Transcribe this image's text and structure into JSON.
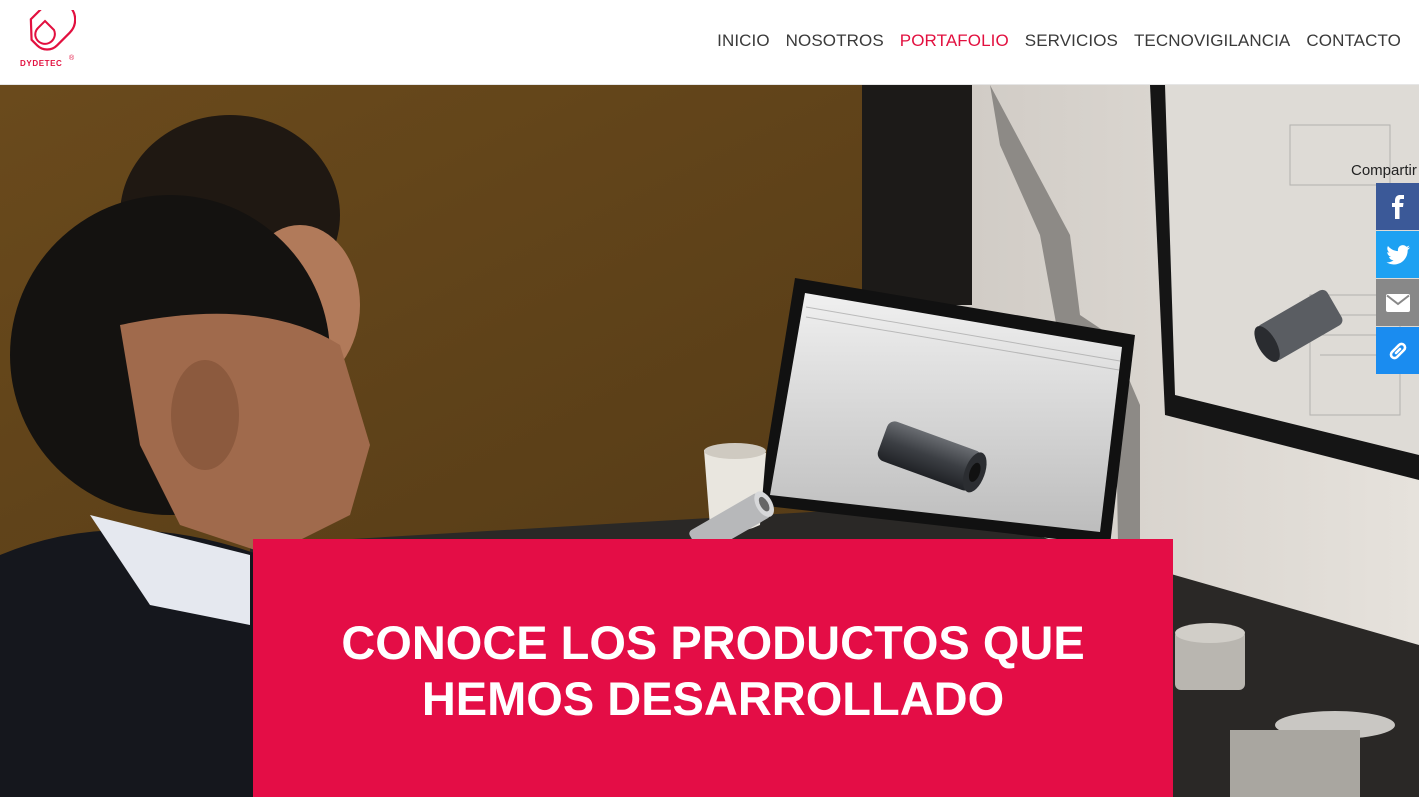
{
  "brand": {
    "name": "DYDETEC",
    "registered_mark": "®",
    "color": "#e2103f"
  },
  "nav": {
    "items": [
      {
        "label": "INICIO",
        "active": false
      },
      {
        "label": "NOSOTROS",
        "active": false
      },
      {
        "label": "PORTAFOLIO",
        "active": true
      },
      {
        "label": "SERVICIOS",
        "active": false
      },
      {
        "label": "TECNOVIGILANCIA",
        "active": false
      },
      {
        "label": "CONTACTO",
        "active": false
      }
    ]
  },
  "share": {
    "label": "Compartir",
    "buttons": [
      {
        "icon": "facebook-icon",
        "color": "#3b5998"
      },
      {
        "icon": "twitter-icon",
        "color": "#1da1f2"
      },
      {
        "icon": "email-icon",
        "color": "#888888"
      },
      {
        "icon": "link-icon",
        "color": "#1a8cf0"
      }
    ]
  },
  "hero": {
    "image": "photo of engineers reviewing a CAD model of a cylindrical part on a laptop",
    "banner_color": "#e40d46",
    "title_line1": "CONOCE LOS PRODUCTOS QUE",
    "title_line2": "HEMOS DESARROLLADO"
  }
}
